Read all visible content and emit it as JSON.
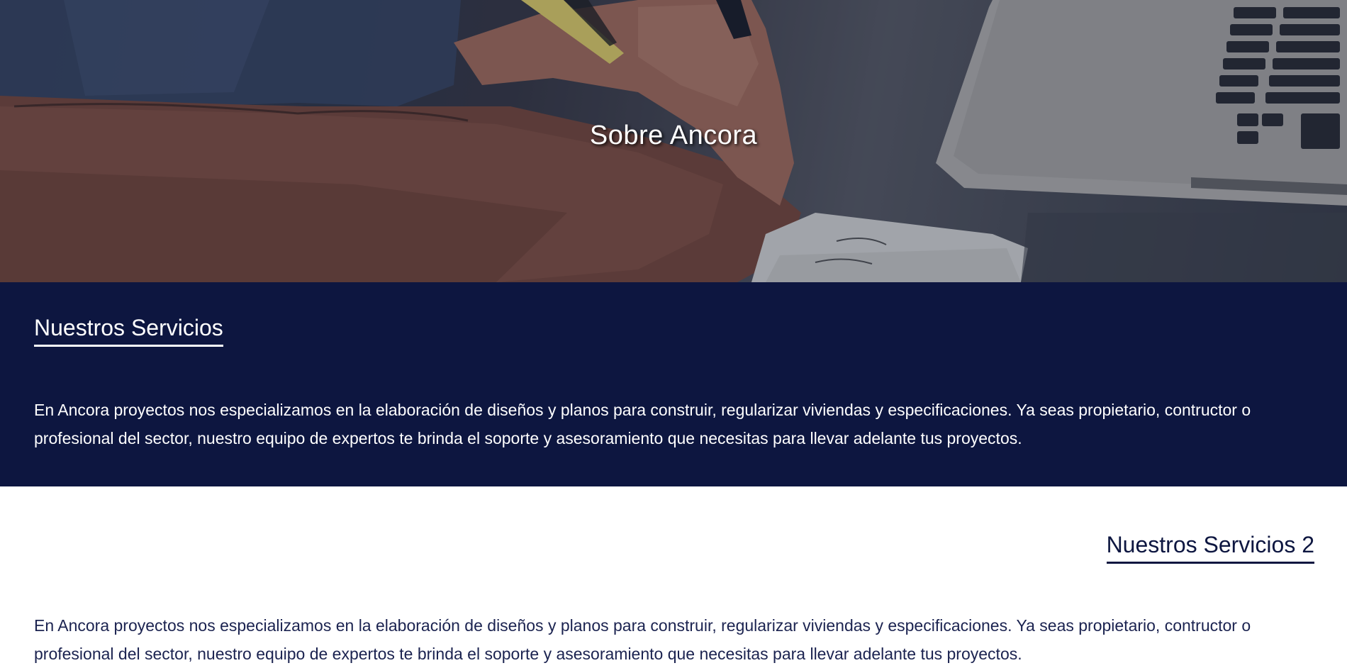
{
  "hero": {
    "title": "Sobre Ancora",
    "image": "hands-writing-on-paper-with-laptop-photo"
  },
  "services": {
    "title": "Nuestros Servicios",
    "text": "En Ancora proyectos nos especializamos en la elaboración de diseños y planos para construir, regularizar viviendas y especificaciones. Ya seas propietario, contructor o profesional del sector, nuestro equipo de expertos te brinda el soporte y asesoramiento que necesitas para llevar adelante tus proyectos."
  },
  "services2": {
    "title": "Nuestros Servicios 2",
    "text": "En Ancora proyectos nos especializamos en la elaboración de diseños y planos para construir, regularizar viviendas y especificaciones. Ya seas propietario, contructor o profesional del sector, nuestro equipo de expertos te brinda el soporte y asesoramiento que necesitas para llevar adelante tus proyectos."
  },
  "colors": {
    "navy": "#0d1640",
    "white": "#ffffff"
  }
}
